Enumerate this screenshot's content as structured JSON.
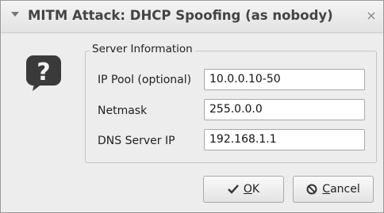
{
  "window": {
    "title": "MITM Attack: DHCP Spoofing (as nobody)",
    "close_glyph": "×"
  },
  "icons": {
    "dialog": "question-help-icon",
    "ok": "checkmark-icon",
    "cancel": "cancel-circle-icon"
  },
  "group": {
    "legend": "Server Information",
    "fields": [
      {
        "label": "IP Pool (optional)",
        "value": "10.0.0.10-50"
      },
      {
        "label": "Netmask",
        "value": "255.0.0.0"
      },
      {
        "label": "DNS Server IP",
        "value": "192.168.1.1"
      }
    ]
  },
  "buttons": {
    "ok_mnemonic": "O",
    "ok_rest": "K",
    "cancel_mnemonic": "C",
    "cancel_rest": "ancel"
  }
}
